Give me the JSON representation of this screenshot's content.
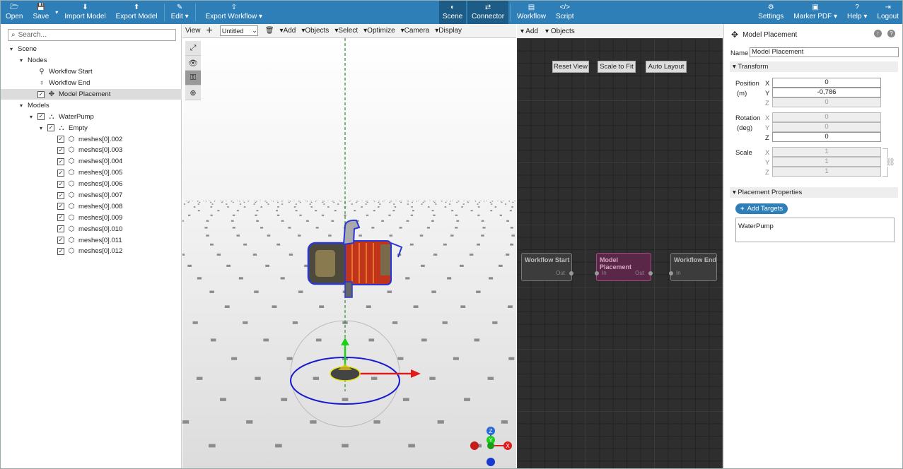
{
  "topbar": {
    "left": [
      {
        "icon": "folder-open-icon",
        "glyph": "🗁",
        "label": "Open"
      },
      {
        "icon": "save-icon",
        "glyph": "💾",
        "label": "Save"
      },
      {
        "icon": "import-icon",
        "glyph": "⬇",
        "label": "Import Model"
      },
      {
        "icon": "export-icon",
        "glyph": "⬆",
        "label": "Export Model"
      },
      {
        "icon": "edit-icon",
        "glyph": "✎",
        "label": "Edit"
      },
      {
        "icon": "export-workflow-icon",
        "glyph": "⇪",
        "label": "Export Workflow"
      }
    ],
    "center": [
      {
        "icon": "scene-icon",
        "glyph": "◐",
        "label": "Scene"
      },
      {
        "icon": "connector-icon",
        "glyph": "⇄",
        "label": "Connector"
      },
      {
        "icon": "workflow-icon",
        "glyph": "▤",
        "label": "Workflow"
      },
      {
        "icon": "script-icon",
        "glyph": "</>",
        "label": "Script"
      }
    ],
    "right": [
      {
        "icon": "settings-icon",
        "glyph": "⚙",
        "label": "Settings"
      },
      {
        "icon": "marker-pdf-icon",
        "glyph": "▣",
        "label": "Marker PDF"
      },
      {
        "icon": "help-icon",
        "glyph": "?",
        "label": "Help"
      },
      {
        "icon": "logout-icon",
        "glyph": "⇥",
        "label": "Logout"
      }
    ]
  },
  "sidebar": {
    "search_placeholder": "Search...",
    "tree": [
      {
        "label": "Scene",
        "depth": 0,
        "toggle": "▾",
        "check": false,
        "icon": ""
      },
      {
        "label": "Nodes",
        "depth": 1,
        "toggle": "▾",
        "check": false,
        "icon": ""
      },
      {
        "label": "Workflow Start",
        "depth": 3,
        "toggle": "",
        "check": false,
        "icon": "⚲"
      },
      {
        "label": "Workflow End",
        "depth": 3,
        "toggle": "",
        "check": false,
        "icon": "♁"
      },
      {
        "label": "Model Placement",
        "depth": 3,
        "toggle": "",
        "check": true,
        "icon": "✥",
        "selected": true
      },
      {
        "label": "Models",
        "depth": 1,
        "toggle": "▾",
        "check": false,
        "icon": ""
      },
      {
        "label": "WaterPump",
        "depth": 2,
        "toggle": "▾",
        "check": true,
        "icon": "⛬"
      },
      {
        "label": "Empty",
        "depth": 3,
        "toggle": "▾",
        "check": true,
        "icon": "⛬"
      },
      {
        "label": "meshes[0].002",
        "depth": 5,
        "toggle": "",
        "check": true,
        "icon": "⬡"
      },
      {
        "label": "meshes[0].003",
        "depth": 5,
        "toggle": "",
        "check": true,
        "icon": "⬡"
      },
      {
        "label": "meshes[0].004",
        "depth": 5,
        "toggle": "",
        "check": true,
        "icon": "⬡"
      },
      {
        "label": "meshes[0].005",
        "depth": 5,
        "toggle": "",
        "check": true,
        "icon": "⬡"
      },
      {
        "label": "meshes[0].006",
        "depth": 5,
        "toggle": "",
        "check": true,
        "icon": "⬡"
      },
      {
        "label": "meshes[0].007",
        "depth": 5,
        "toggle": "",
        "check": true,
        "icon": "⬡"
      },
      {
        "label": "meshes[0].008",
        "depth": 5,
        "toggle": "",
        "check": true,
        "icon": "⬡"
      },
      {
        "label": "meshes[0].009",
        "depth": 5,
        "toggle": "",
        "check": true,
        "icon": "⬡"
      },
      {
        "label": "meshes[0].010",
        "depth": 5,
        "toggle": "",
        "check": true,
        "icon": "⬡"
      },
      {
        "label": "meshes[0].011",
        "depth": 5,
        "toggle": "",
        "check": true,
        "icon": "⬡"
      },
      {
        "label": "meshes[0].012",
        "depth": 5,
        "toggle": "",
        "check": true,
        "icon": "⬡"
      }
    ]
  },
  "viewport": {
    "view_label": "View",
    "add_icon": "+",
    "scene_select": "Untitled",
    "menus": [
      "Add",
      "Objects",
      "Select",
      "Optimize",
      "Camera",
      "Display"
    ],
    "gizmo_axes": {
      "x": "X",
      "y": "Y",
      "z": "Z"
    }
  },
  "connector": {
    "menus": [
      "Add",
      "Objects"
    ],
    "buttons": [
      "Reset View",
      "Scale to Fit",
      "Auto Layout"
    ],
    "nodes": {
      "start": {
        "title": "Workflow Start",
        "out": "Out"
      },
      "placement": {
        "title": "Model Placement",
        "in": "In",
        "out": "Out"
      },
      "end": {
        "title": "Workflow End",
        "in": "In"
      }
    }
  },
  "inspector": {
    "title": "Model Placement",
    "name_label": "Name",
    "name_value": "Model Placement",
    "transform_label": "Transform",
    "position_label": "Position",
    "position_unit": "(m)",
    "rotation_label": "Rotation",
    "rotation_unit": "(deg)",
    "scale_label": "Scale",
    "axes": [
      "X",
      "Y",
      "Z"
    ],
    "position": [
      "0",
      "-0,786",
      "0"
    ],
    "rotation": [
      "0",
      "0",
      "0"
    ],
    "scale": [
      "1",
      "1",
      "1"
    ],
    "placement_props_label": "Placement Properties",
    "add_targets_label": "Add Targets",
    "targets": "WaterPump"
  }
}
